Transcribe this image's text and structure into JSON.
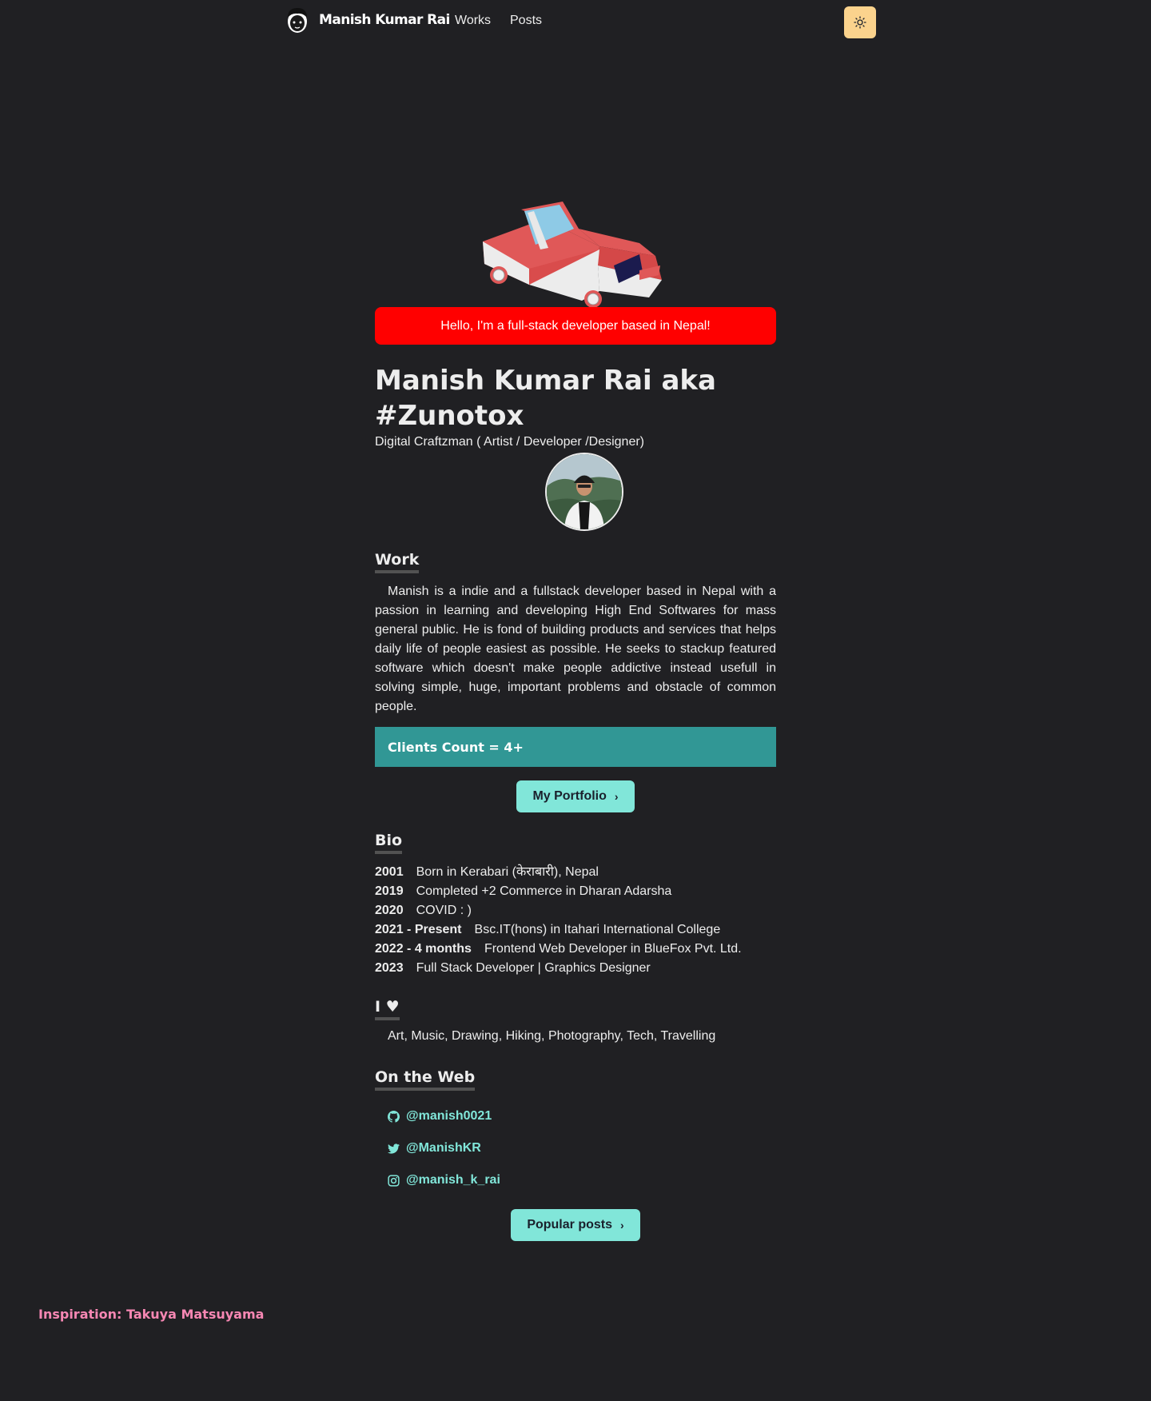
{
  "nav": {
    "logo_text": "Manish Kumar Rai",
    "links": [
      "Works",
      "Posts"
    ],
    "theme_icon": "sun-icon",
    "theme_button_color": "#fbd38d"
  },
  "hero": {
    "greeting": "Hello, I'm a full-stack developer based in Nepal!",
    "greeting_bg": "#ff0000",
    "name": "Manish Kumar Rai aka #Zunotox",
    "tagline": "Digital Craftzman ( Artist / Developer /Designer)"
  },
  "work": {
    "heading": "Work",
    "text": "Manish is a indie and a fullstack developer based in Nepal with a passion in learning and developing High End Softwares for mass general public. He is fond of building products and services that helps daily life of people easiest as possible. He seeks to stackup featured software which doesn't make people addictive instead usefull in solving simple, huge, important problems and obstacle of common people.",
    "clients": "Clients Count = 4+",
    "portfolio_button": "My Portfolio"
  },
  "bio": {
    "heading": "Bio",
    "entries": [
      {
        "year": "2001",
        "text": "Born in Kerabari (केराबारी), Nepal"
      },
      {
        "year": "2019",
        "text": "Completed +2 Commerce in Dharan Adarsha"
      },
      {
        "year": "2020",
        "text": "COVID : )"
      },
      {
        "year": "2021 - Present",
        "text": "Bsc.IT(hons) in Itahari International College"
      },
      {
        "year": "2022 - 4 months",
        "text": "Frontend Web Developer in BlueFox Pvt. Ltd."
      },
      {
        "year": "2023",
        "text": "Full Stack Developer | Graphics Designer"
      }
    ]
  },
  "love": {
    "heading": "I ♥",
    "text": "Art, Music, Drawing, Hiking, Photography, Tech, Travelling"
  },
  "web": {
    "heading": "On the Web",
    "links": [
      {
        "icon": "github-icon",
        "handle": "@manish0021"
      },
      {
        "icon": "twitter-icon",
        "handle": "@ManishKR"
      },
      {
        "icon": "instagram-icon",
        "handle": "@manish_k_rai"
      }
    ],
    "posts_button": "Popular posts"
  },
  "footer": {
    "inspiration": "Inspiration: Takuya Matsuyama"
  },
  "colors": {
    "background": "#202023",
    "teal": "#319795",
    "teal_light": "#81e6d9",
    "pink": "#f687b3"
  }
}
